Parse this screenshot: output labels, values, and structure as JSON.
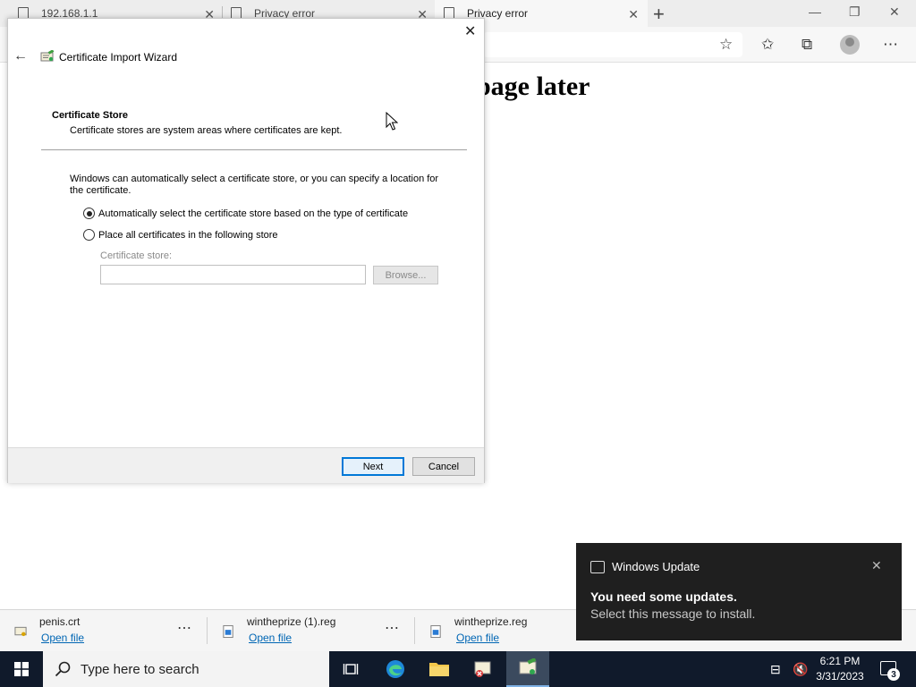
{
  "browser": {
    "tabs": [
      {
        "title": "192.168.1.1"
      },
      {
        "title": "Privacy error"
      },
      {
        "title": "Privacy error"
      }
    ],
    "page_heading": "page later"
  },
  "wizard": {
    "title": "Certificate Import Wizard",
    "section_title": "Certificate Store",
    "section_subtitle": "Certificate stores are system areas where certificates are kept.",
    "intro": "Windows can automatically select a certificate store, or you can specify a location for the certificate.",
    "options": [
      {
        "label": "Automatically select the certificate store based on the type of certificate",
        "selected": true
      },
      {
        "label": "Place all certificates in the following store",
        "selected": false
      }
    ],
    "store_label": "Certificate store:",
    "store_value": "",
    "browse_label": "Browse...",
    "next_label": "Next",
    "cancel_label": "Cancel"
  },
  "downloads": [
    {
      "name": "penis.crt",
      "action": "Open file"
    },
    {
      "name": "wintheprize (1).reg",
      "action": "Open file"
    },
    {
      "name": "wintheprize.reg",
      "action": "Open file"
    }
  ],
  "toast": {
    "app": "Windows Update",
    "title": "You need some updates.",
    "message": "Select this message to install."
  },
  "taskbar": {
    "search_placeholder": "Type here to search",
    "time": "6:21 PM",
    "date": "3/31/2023",
    "notification_count": "3"
  },
  "colors": {
    "accent": "#0078d7",
    "taskbar": "#101a2b",
    "toast": "#1f1f1f",
    "link": "#0066b4"
  }
}
